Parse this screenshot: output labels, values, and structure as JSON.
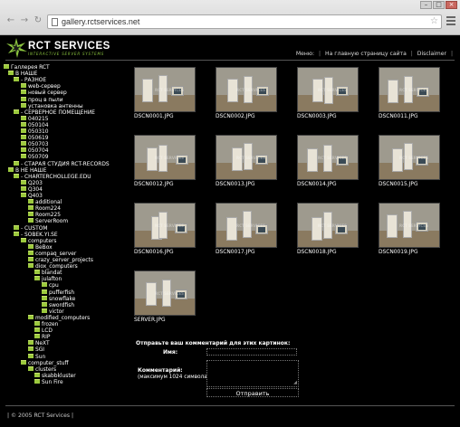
{
  "browser": {
    "url": "gallery.rctservices.net",
    "back_icon": "back-arrow-icon",
    "forward_icon": "forward-arrow-icon",
    "reload_icon": "reload-icon"
  },
  "site": {
    "logo_title": "RCT SERVICES",
    "logo_subtitle": "INTERACTIVE SERVER SYSTEMS",
    "accent_color": "#8cc63f"
  },
  "topmenu": {
    "label": "Меню:",
    "home": "На главную страницу сайта",
    "disclaimer": "Disclaimer",
    "separator": "|"
  },
  "tree": [
    {
      "label": "Галлерея RCT",
      "level": 0
    },
    {
      "label": "В НАШЕ",
      "level": 1
    },
    {
      "label": "- РАЗНОЕ",
      "level": 2
    },
    {
      "label": "web-сервер",
      "level": 3
    },
    {
      "label": "новый сервер",
      "level": 3
    },
    {
      "label": "проц в пыли",
      "level": 3
    },
    {
      "label": "установка антенны",
      "level": 3
    },
    {
      "label": "- СЕРВЕРНОЕ ПОМЕЩЕНИЕ",
      "level": 2
    },
    {
      "label": "040215",
      "level": 3
    },
    {
      "label": "050104",
      "level": 3
    },
    {
      "label": "050310",
      "level": 3
    },
    {
      "label": "050619",
      "level": 3
    },
    {
      "label": "050703",
      "level": 3
    },
    {
      "label": "050704",
      "level": 3
    },
    {
      "label": "050709",
      "level": 3
    },
    {
      "label": "- СТАРАЯ СТУДИЯ RCT-RECORDS",
      "level": 2
    },
    {
      "label": "В НЕ НАШЕ",
      "level": 1
    },
    {
      "label": "- CHARTERCHOLLEGE.EDU",
      "level": 2
    },
    {
      "label": "Q203",
      "level": 3
    },
    {
      "label": "Q304",
      "level": 3
    },
    {
      "label": "Q403",
      "level": 3
    },
    {
      "label": "additional",
      "level": 4
    },
    {
      "label": "Room224",
      "level": 4
    },
    {
      "label": "Room225",
      "level": 4
    },
    {
      "label": "ServerRoom",
      "level": 4
    },
    {
      "label": "- CUSTOM",
      "level": 2
    },
    {
      "label": "- SOBEK.YI.SE",
      "level": 2
    },
    {
      "label": "computers",
      "level": 3
    },
    {
      "label": "BeBox",
      "level": 4
    },
    {
      "label": "compaq_server",
      "level": 4
    },
    {
      "label": "crazy_server_projects",
      "level": 4
    },
    {
      "label": "diox_computers",
      "level": 4
    },
    {
      "label": "blandat",
      "level": 5
    },
    {
      "label": "julafton",
      "level": 5
    },
    {
      "label": "cpu",
      "level": 6
    },
    {
      "label": "pufferfish",
      "level": 6
    },
    {
      "label": "snowflake",
      "level": 6
    },
    {
      "label": "swordfish",
      "level": 6
    },
    {
      "label": "victor",
      "level": 6
    },
    {
      "label": "modified_computers",
      "level": 4
    },
    {
      "label": "frozen",
      "level": 5
    },
    {
      "label": "LCD",
      "level": 5
    },
    {
      "label": "RIP",
      "level": 5
    },
    {
      "label": "NeXT",
      "level": 4
    },
    {
      "label": "SGI",
      "level": 4
    },
    {
      "label": "Sun",
      "level": 4
    },
    {
      "label": "computer_stuff",
      "level": 3
    },
    {
      "label": "clusters",
      "level": 4
    },
    {
      "label": "skabbkluster",
      "level": 5
    },
    {
      "label": "Sun Fire",
      "level": 5
    }
  ],
  "gallery": [
    {
      "caption": "DSCN0001.JPG"
    },
    {
      "caption": "DSCN0002.JPG"
    },
    {
      "caption": "DSCN0003.JPG"
    },
    {
      "caption": "DSCN0011.JPG"
    },
    {
      "caption": "DSCN0012.JPG"
    },
    {
      "caption": "DSCN0013.JPG"
    },
    {
      "caption": "DSCN0014.JPG"
    },
    {
      "caption": "DSCN0015.JPG"
    },
    {
      "caption": "DSCN0016.JPG"
    },
    {
      "caption": "DSCN0017.JPG"
    },
    {
      "caption": "DSCN0018.JPG"
    },
    {
      "caption": "DSCN0019.JPG"
    },
    {
      "caption": "SERVER.JPG"
    }
  ],
  "watermark": "RCT SERVICES",
  "form": {
    "title": "Отправьте ваш комментарий для этих картинок:",
    "name_label": "Имя:",
    "name_value": "",
    "comment_label": "Комментарий:",
    "comment_hint": "(максимум 1024 символа)",
    "comment_value": "",
    "submit_label": "Отправить"
  },
  "footer": {
    "text": "| © 2005 RCT Services |"
  }
}
